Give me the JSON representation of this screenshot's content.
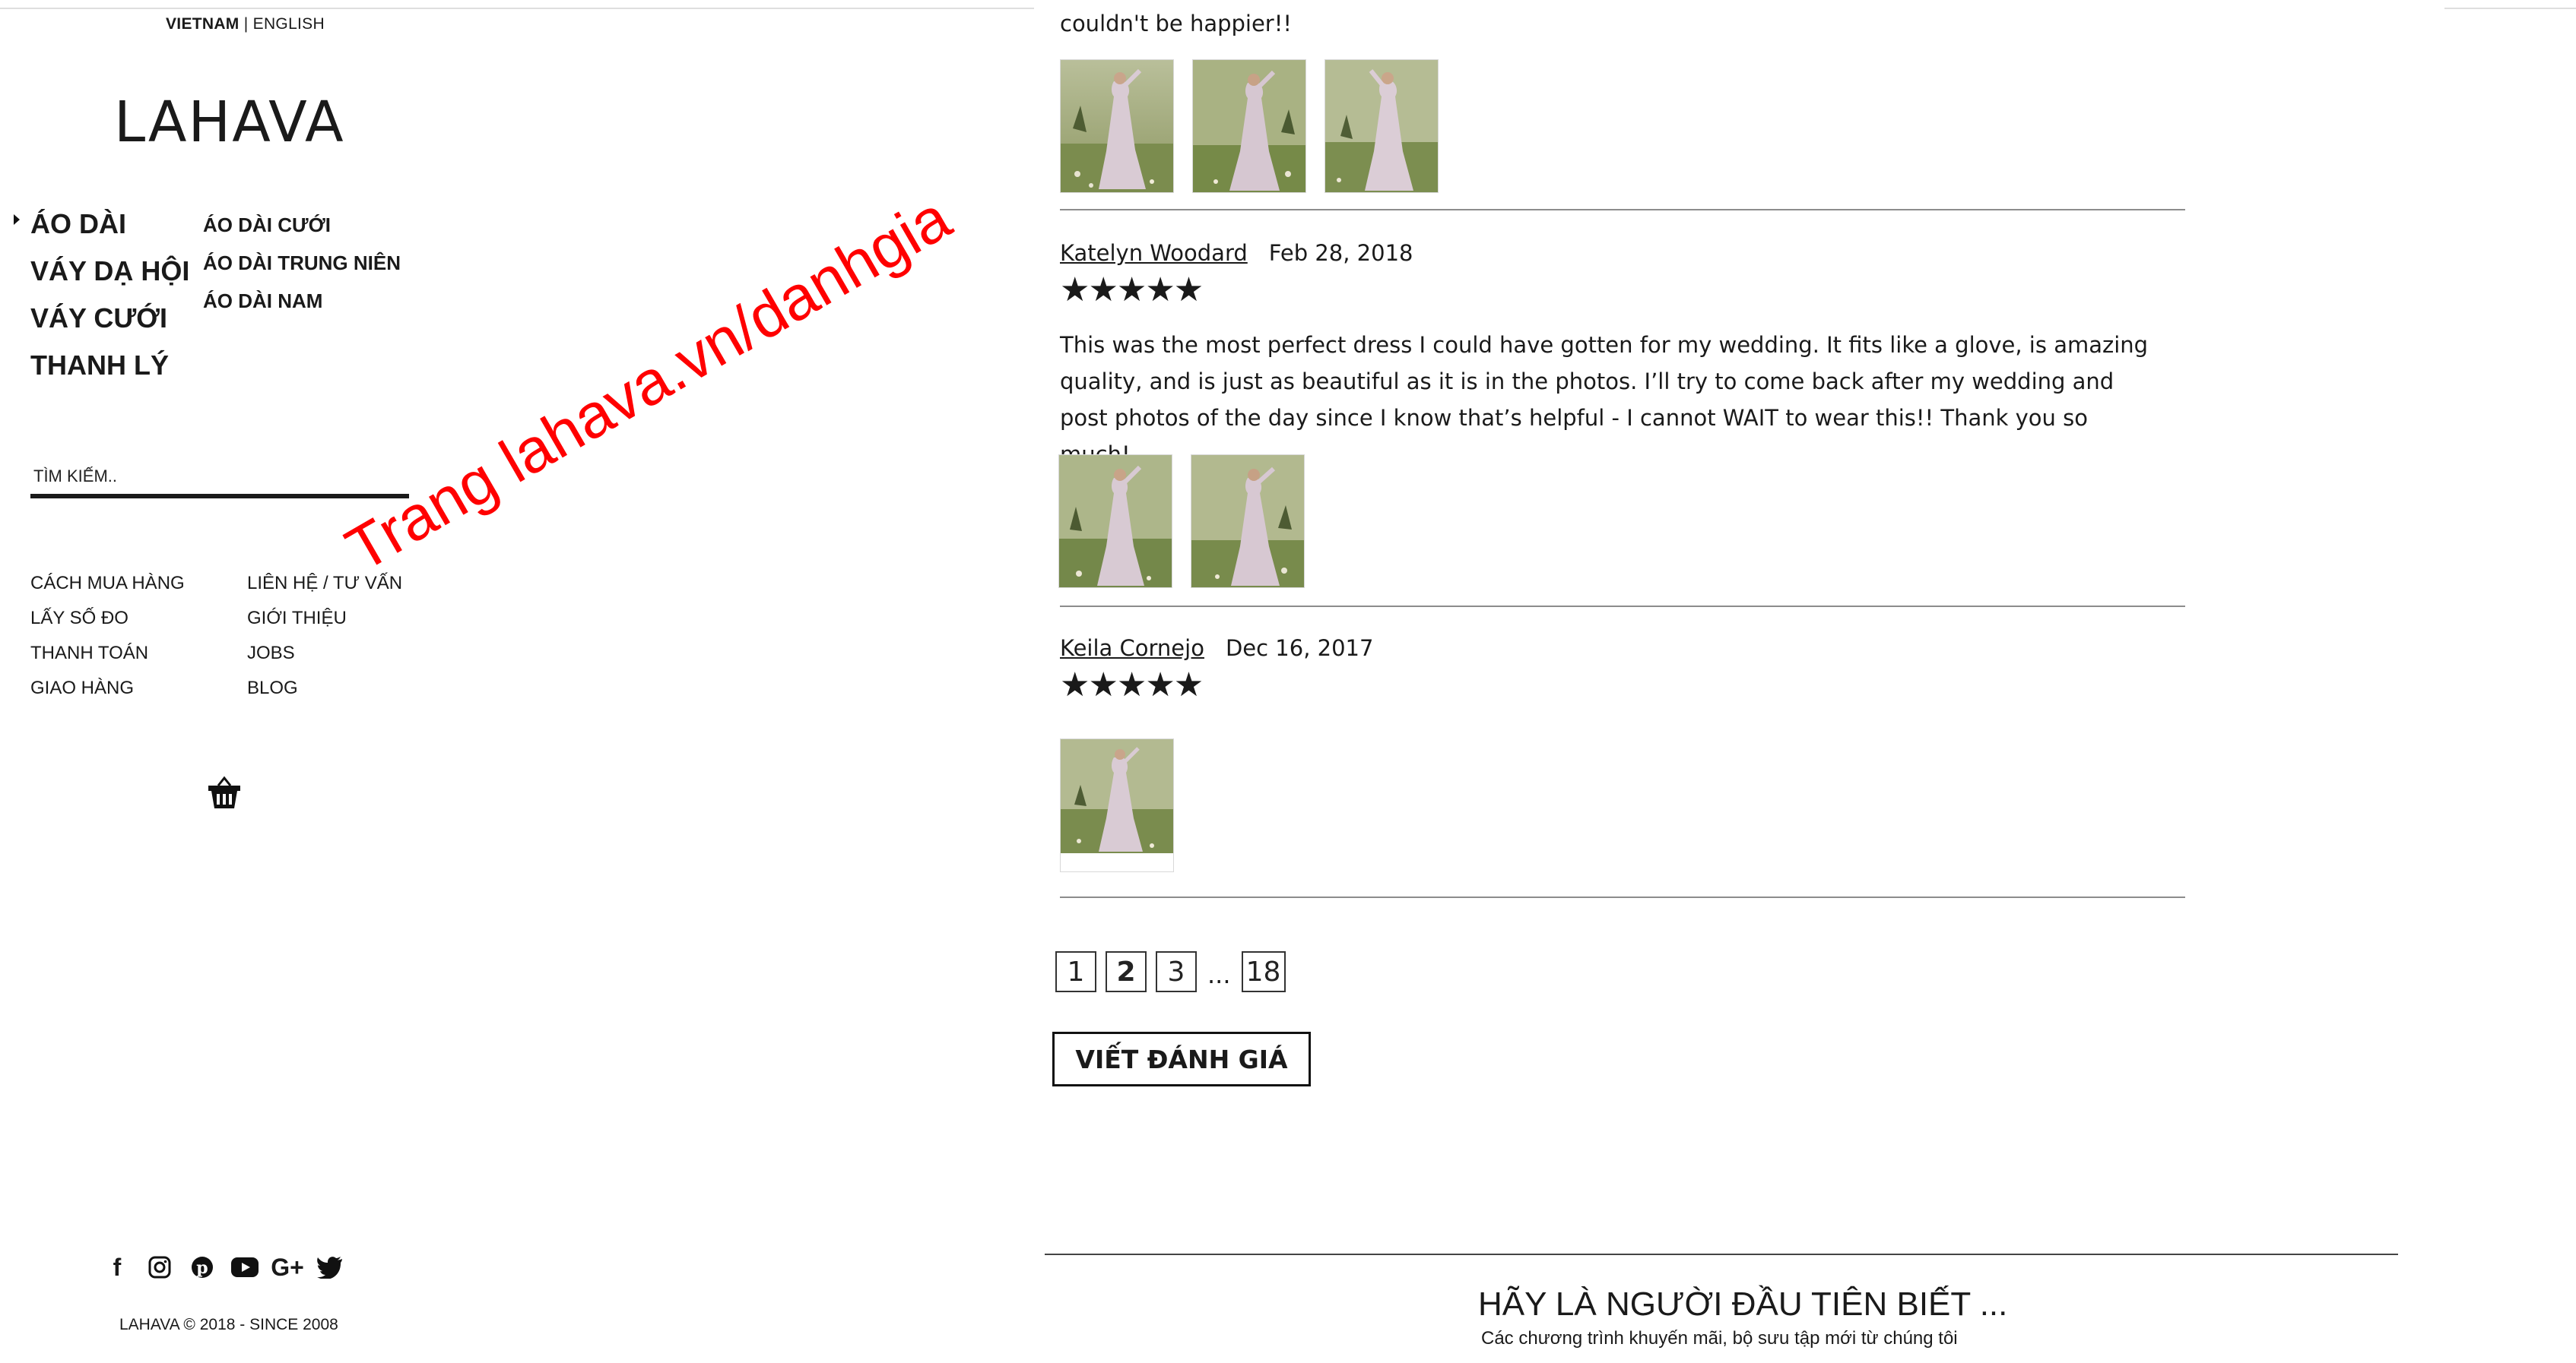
{
  "sidebar": {
    "lang_active": "VIETNAM",
    "lang_sep": "|",
    "lang_other": "ENGLISH",
    "logo": "LAHAVA",
    "categories": [
      "ÁO DÀI",
      "VÁY DẠ HỘI",
      "VÁY CƯỚI",
      "THANH LÝ"
    ],
    "subcategories": [
      "ÁO DÀI CƯỚI",
      "ÁO DÀI TRUNG NIÊN",
      "ÁO DÀI NAM"
    ],
    "search_placeholder": "TÌM KIẾM..",
    "links_left": [
      "CÁCH MUA HÀNG",
      "LẤY SỐ ĐO",
      "THANH TOÁN",
      "GIAO HÀNG"
    ],
    "links_right": [
      "LIÊN HỆ / TƯ VẤN",
      "GIỚI THIỆU",
      "JOBS",
      "BLOG"
    ],
    "social_icons": [
      "facebook-icon",
      "instagram-icon",
      "pinterest-icon",
      "youtube-icon",
      "google-plus-icon",
      "twitter-icon"
    ],
    "copyright": "LAHAVA © 2018 - SINCE 2008"
  },
  "watermark": "Trang lahava.vn/danhgia",
  "reviews": {
    "fragment": "couldn't be happier!!",
    "items": [
      {
        "author": "Katelyn Woodard",
        "date": "Feb 28, 2018",
        "stars": "★★★★★",
        "text": "This was the most perfect dress I could have gotten for my wedding. It fits like a glove, is amazing quality, and is just as beautiful as it is in the photos. I’ll try to come back after my wedding and post photos of the day since I know that’s helpful - I cannot WAIT to wear this!! Thank you so much!"
      },
      {
        "author": "Keila Cornejo",
        "date": "Dec 16, 2017",
        "stars": "★★★★★",
        "text": ""
      }
    ]
  },
  "pagination": {
    "pages": [
      "1",
      "2",
      "3"
    ],
    "ellipsis": "...",
    "last": "18",
    "current": "2"
  },
  "write_review_label": "VIẾT ĐÁNH GIÁ",
  "newsletter": {
    "title": "HÃY LÀ NGƯỜI ĐẦU TIÊN BIẾT ...",
    "subtitle": "Các chương trình khuyến mãi, bộ sưu tập mới từ chúng tôi"
  },
  "colors": {
    "watermark": "#ff0000",
    "text": "#1a1a1a",
    "divider": "#8c8c8c"
  }
}
